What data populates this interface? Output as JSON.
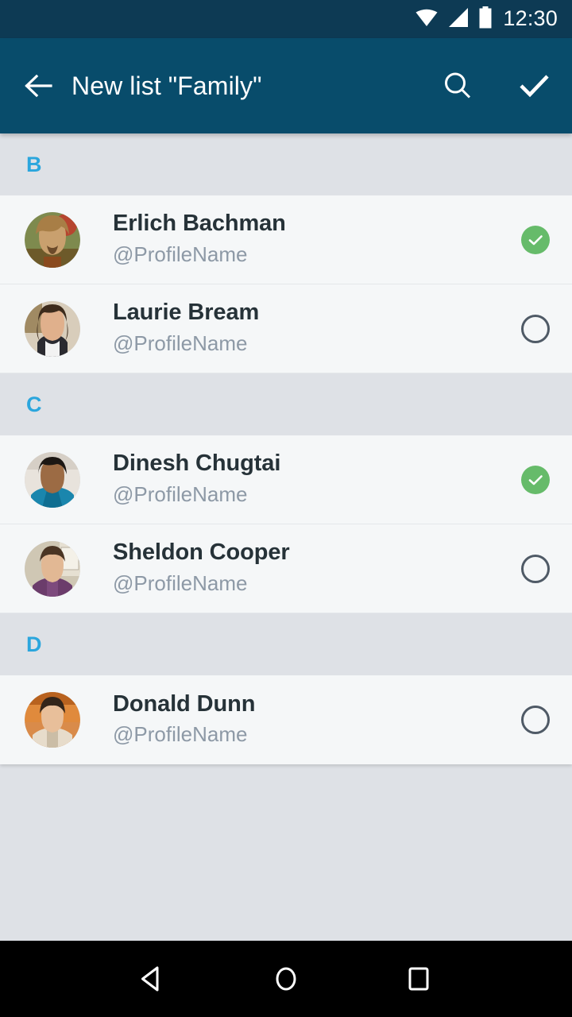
{
  "status_bar": {
    "time": "12:30",
    "icons": [
      "wifi-icon",
      "signal-icon",
      "battery-icon"
    ],
    "background": "#0d3a54"
  },
  "app_bar": {
    "background": "#084c6b",
    "back_label": "Back",
    "title": "New list \"Family\"",
    "search_label": "Search",
    "confirm_label": "Done"
  },
  "theme": {
    "accent_blue": "#2ba6dd",
    "selected_green": "#66bb6a",
    "row_background": "#f5f7f8",
    "section_background": "#dee1e6",
    "name_color": "#263238",
    "handle_color": "#8d99a6",
    "unselected_ring": "#4f5a66"
  },
  "list": {
    "sections": [
      {
        "letter": "B",
        "contacts": [
          {
            "name": "Erlich Bachman",
            "handle": "@ProfileName",
            "selected": true,
            "avatar": "avatar-erlich"
          },
          {
            "name": "Laurie Bream",
            "handle": "@ProfileName",
            "selected": false,
            "avatar": "avatar-laurie"
          }
        ]
      },
      {
        "letter": "C",
        "contacts": [
          {
            "name": "Dinesh Chugtai",
            "handle": "@ProfileName",
            "selected": true,
            "avatar": "avatar-dinesh"
          },
          {
            "name": "Sheldon Cooper",
            "handle": "@ProfileName",
            "selected": false,
            "avatar": "avatar-sheldon"
          }
        ]
      },
      {
        "letter": "D",
        "contacts": [
          {
            "name": "Donald Dunn",
            "handle": "@ProfileName",
            "selected": false,
            "avatar": "avatar-donald"
          }
        ]
      }
    ]
  },
  "nav_bar": {
    "background": "#000000",
    "buttons": [
      {
        "name": "back-nav-button",
        "label": "Back"
      },
      {
        "name": "home-nav-button",
        "label": "Home"
      },
      {
        "name": "recents-nav-button",
        "label": "Recents"
      }
    ]
  }
}
